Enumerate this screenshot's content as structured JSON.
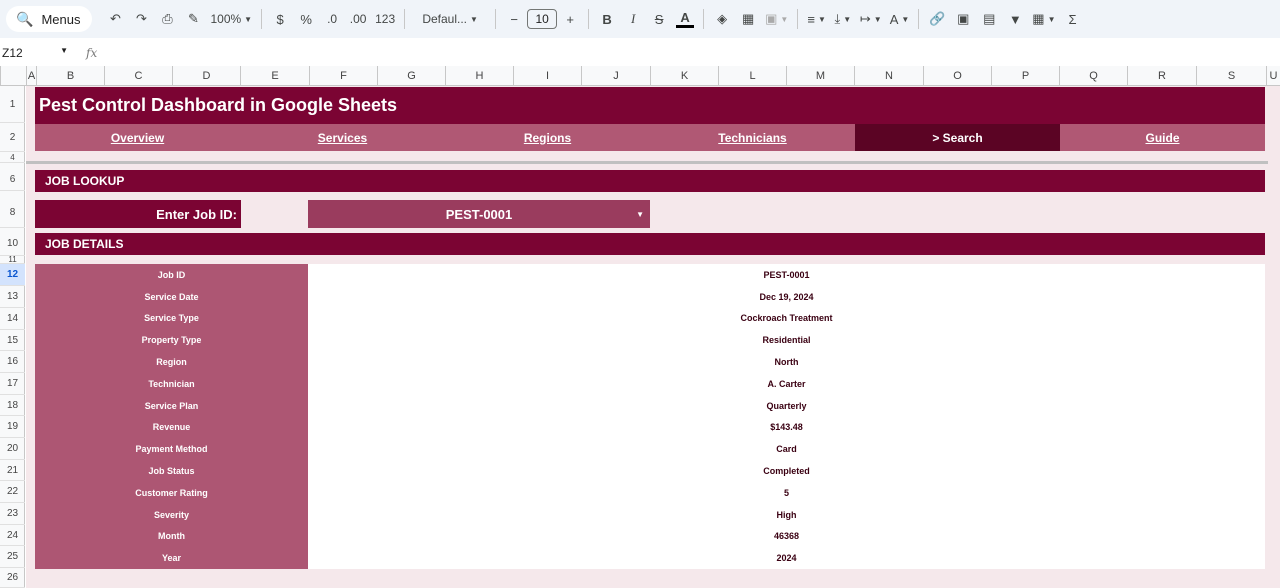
{
  "toolbar": {
    "menus_label": "Menus",
    "zoom": "100%",
    "currency": "$",
    "percent": "%",
    "dec_decrease": ".0",
    "dec_increase": ".00",
    "number_format": "123",
    "font": "Defaul...",
    "font_size": "10",
    "bold": "B",
    "italic": "I",
    "strike": "S",
    "text_color": "A",
    "sum": "Σ"
  },
  "formula_bar": {
    "cell_ref": "Z12",
    "fx": "fx"
  },
  "columns": [
    "A",
    "B",
    "C",
    "D",
    "E",
    "F",
    "G",
    "H",
    "I",
    "J",
    "K",
    "L",
    "M",
    "N",
    "O",
    "P",
    "Q",
    "R",
    "S",
    "U"
  ],
  "rows": [
    "1",
    "2",
    "4",
    "6",
    "8",
    "10",
    "11",
    "12",
    "13",
    "14",
    "15",
    "16",
    "17",
    "18",
    "19",
    "20",
    "21",
    "22",
    "23",
    "24",
    "25",
    "26"
  ],
  "sheet": {
    "title": "Pest Control Dashboard in Google Sheets",
    "nav": [
      "Overview",
      "Services",
      "Regions",
      "Technicians",
      "> Search",
      "Guide"
    ],
    "active_nav": "> Search",
    "job_lookup_header": "JOB LOOKUP",
    "enter_label": "Enter Job ID:",
    "job_id_value": "PEST-0001",
    "job_details_header": "JOB DETAILS",
    "details": [
      {
        "label": "Job ID",
        "value": "PEST-0001"
      },
      {
        "label": "Service Date",
        "value": "Dec 19, 2024"
      },
      {
        "label": "Service Type",
        "value": "Cockroach Treatment"
      },
      {
        "label": "Property Type",
        "value": "Residential"
      },
      {
        "label": "Region",
        "value": "North"
      },
      {
        "label": "Technician",
        "value": "A. Carter"
      },
      {
        "label": "Service Plan",
        "value": "Quarterly"
      },
      {
        "label": "Revenue",
        "value": "$143.48"
      },
      {
        "label": "Payment Method",
        "value": "Card"
      },
      {
        "label": "Job Status",
        "value": "Completed"
      },
      {
        "label": "Customer Rating",
        "value": "5"
      },
      {
        "label": "Severity",
        "value": "High"
      },
      {
        "label": "Month",
        "value": "46368"
      },
      {
        "label": "Year",
        "value": "2024"
      }
    ]
  },
  "colors": {
    "primary": "#7b0433",
    "nav_bg": "#b05874",
    "nav_active": "#5b0424",
    "label_bg": "#ad5673",
    "dropdown_bg": "#9a3c5e",
    "sheet_bg": "#f5e8eb"
  }
}
